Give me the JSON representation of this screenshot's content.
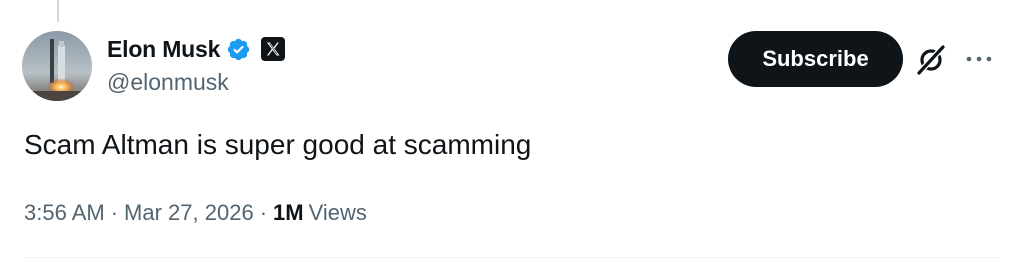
{
  "tweet": {
    "author": {
      "display_name": "Elon Musk",
      "handle": "@elonmusk",
      "verified_color": "#1d9bf0",
      "avatar_icon": "rocket-launch-avatar",
      "affiliate_icon": "x-logo-icon"
    },
    "subscribe_label": "Subscribe",
    "grok_icon": "grok-icon",
    "more_icon": "more-icon",
    "text": "Scam Altman is super good at scamming",
    "time": "3:56 AM",
    "date": "Mar 27, 2026",
    "separator": "·",
    "views_count": "1M",
    "views_label": "Views"
  },
  "colors": {
    "text_primary": "#0f1419",
    "text_secondary": "#536471",
    "button_bg": "#0f1419",
    "verified": "#1d9bf0"
  }
}
